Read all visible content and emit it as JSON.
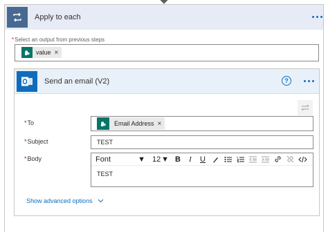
{
  "loop": {
    "title": "Apply to each",
    "select_label": "Select an output from previous steps",
    "select_token": "value"
  },
  "action": {
    "title": "Send an email (V2)",
    "fields": {
      "to_label": "To",
      "to_token": "Email Address",
      "subject_label": "Subject",
      "subject_value": "TEST",
      "body_label": "Body",
      "body_value": "TEST"
    },
    "toolbar": {
      "font": "Font",
      "size": "12"
    },
    "advanced_label": "Show advanced options"
  },
  "icons": {
    "loop": "loop-icon",
    "outlook": "outlook-icon",
    "token": "sharepoint-icon",
    "help": "help-icon",
    "more": "more-icon",
    "swap": "swap-icon"
  },
  "colors": {
    "loop_header": "#e6ebf5",
    "loop_icon": "#486991",
    "action_header": "#e8f1f9",
    "accent": "#0f6cbd",
    "token_icon": "#077568",
    "required": "#a4262c"
  }
}
